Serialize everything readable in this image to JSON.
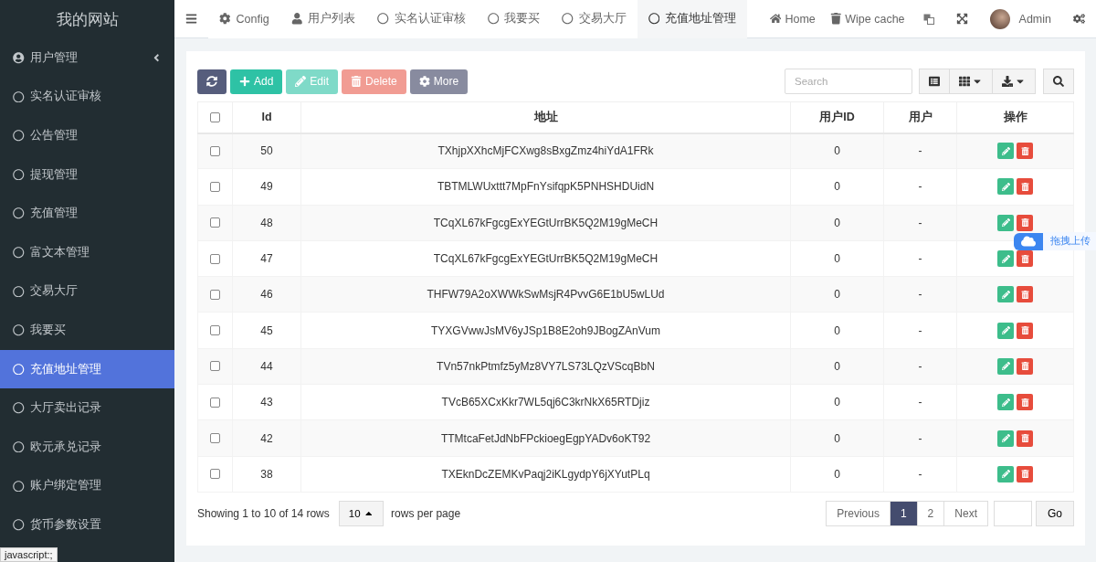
{
  "sidebar": {
    "brand": "我的网站",
    "items": [
      {
        "label": "用户管理",
        "kind": "group",
        "selected": false
      },
      {
        "label": "实名认证审核",
        "kind": "page",
        "selected": false
      },
      {
        "label": "公告管理",
        "kind": "page",
        "selected": false
      },
      {
        "label": "提现管理",
        "kind": "page",
        "selected": false
      },
      {
        "label": "充值管理",
        "kind": "page",
        "selected": false
      },
      {
        "label": "富文本管理",
        "kind": "page",
        "selected": false
      },
      {
        "label": "交易大厅",
        "kind": "page",
        "selected": false
      },
      {
        "label": "我要买",
        "kind": "page",
        "selected": false
      },
      {
        "label": "充值地址管理",
        "kind": "page",
        "selected": true
      },
      {
        "label": "大厅卖出记录",
        "kind": "page",
        "selected": false
      },
      {
        "label": "欧元承兑记录",
        "kind": "page",
        "selected": false
      },
      {
        "label": "账户绑定管理",
        "kind": "page",
        "selected": false
      },
      {
        "label": "货币参数设置",
        "kind": "page",
        "selected": false
      }
    ]
  },
  "tabs": [
    {
      "label": "Config",
      "kind": "gear",
      "selected": false
    },
    {
      "label": "用户列表",
      "kind": "user",
      "selected": false
    },
    {
      "label": "实名认证审核",
      "kind": "circle",
      "selected": false
    },
    {
      "label": "我要买",
      "kind": "circle",
      "selected": false
    },
    {
      "label": "交易大厅",
      "kind": "circle",
      "selected": false
    },
    {
      "label": "充值地址管理",
      "kind": "circle",
      "selected": true
    }
  ],
  "header_links": [
    {
      "label": "Home",
      "kind": "home"
    },
    {
      "label": "Wipe cache",
      "kind": "trash"
    }
  ],
  "user": {
    "name": "Admin"
  },
  "toolbar": {
    "buttons": [
      {
        "kind": "refresh",
        "disabled": false
      },
      {
        "kind": "add",
        "label": "Add",
        "disabled": false
      },
      {
        "kind": "edit",
        "label": "Edit",
        "disabled": true
      },
      {
        "kind": "delete",
        "label": "Delete",
        "disabled": true
      },
      {
        "kind": "more",
        "label": "More",
        "disabled": false
      }
    ],
    "search": {
      "placeholder": "Search"
    }
  },
  "table": {
    "select_all_checked": false,
    "columns": [
      "Id",
      "地址",
      "用户ID",
      "用户",
      "操作"
    ],
    "rows": [
      {
        "id": "50",
        "address": "TXhjpXXhcMjFCXwg8sBxgZmz4hiYdA1FRk",
        "user_id": "0",
        "user": "-",
        "checked": false
      },
      {
        "id": "49",
        "address": "TBTMLWUxttt7MpFnYsifqpK5PNHSHDUidN",
        "user_id": "0",
        "user": "-",
        "checked": false
      },
      {
        "id": "48",
        "address": "TCqXL67kFgcgExYEGtUrrBK5Q2M19gMeCH",
        "user_id": "0",
        "user": "-",
        "checked": false
      },
      {
        "id": "47",
        "address": "TCqXL67kFgcgExYEGtUrrBK5Q2M19gMeCH",
        "user_id": "0",
        "user": "-",
        "checked": false
      },
      {
        "id": "46",
        "address": "THFW79A2oXWWkSwMsjR4PvvG6E1bU5wLUd",
        "user_id": "0",
        "user": "-",
        "checked": false
      },
      {
        "id": "45",
        "address": "TYXGVwwJsMV6yJSp1B8E2oh9JBogZAnVum",
        "user_id": "0",
        "user": "-",
        "checked": false
      },
      {
        "id": "44",
        "address": "TVn57nkPtmfz5yMz8VY7LS73LQzVScqBbN",
        "user_id": "0",
        "user": "-",
        "checked": false
      },
      {
        "id": "43",
        "address": "TVcB65XCxKkr7WL5qj6C3krNkX65RTDjiz",
        "user_id": "0",
        "user": "-",
        "checked": false
      },
      {
        "id": "42",
        "address": "TTMtcaFetJdNbFPckioegEgpYADv6oKT92",
        "user_id": "0",
        "user": "-",
        "checked": false
      },
      {
        "id": "38",
        "address": "TXEknDcZEMKvPaqj2iKLgydpY6jXYutPLq",
        "user_id": "0",
        "user": "-",
        "checked": false
      }
    ]
  },
  "pagination": {
    "summary": "Showing 1 to 10 of 14 rows",
    "page_size": "10",
    "page_size_suffix": "rows per page",
    "previous": "Previous",
    "pages": [
      {
        "label": "1",
        "selected": true
      },
      {
        "label": "2",
        "selected": false
      }
    ],
    "next": "Next",
    "go": "Go"
  },
  "upload_widget": {
    "label": "拖拽上传"
  },
  "status_bar": "javascript:;"
}
